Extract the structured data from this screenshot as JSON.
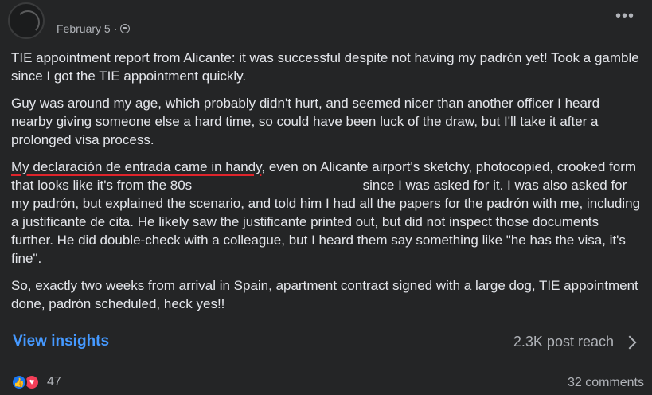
{
  "post": {
    "date": "February 5",
    "dot": "·",
    "privacy_icon": "globe-icon",
    "more_icon": "more-icon"
  },
  "body": {
    "p1": "TIE appointment report from Alicante: it was successful despite not having my padrón yet! Took a gamble since I got the TIE appointment quickly.",
    "p2": "Guy was around my age, which probably didn't hurt, and seemed nicer than another officer I heard nearby giving someone else a hard time, so could have been luck of the draw, but I'll take it after a prolonged visa process.",
    "p3_underlined": "My declaración de entrada came in handy",
    "p3_a": ", even on Alicante airport's sketchy, photocopied, crooked form that looks like it's from the 80s",
    "p3_b": "since I was asked for it. I was also asked for my padrón, but explained the scenario, and told him I had all the papers for the padrón with me, including a justificante de cita. He likely saw the justificante printed out, but did not inspect those documents further. He did double-check with a colleague, but I heard them say something like \"he has the visa, it's fine\".",
    "p4": "So, exactly two weeks from arrival in Spain, apartment contract signed with a large dog, TIE appointment done, padrón scheduled, heck yes!!"
  },
  "footer": {
    "insights_label": "View insights",
    "reach_label": "2.3K post reach",
    "reaction_count": "47",
    "comments_label": "32 comments"
  },
  "colors": {
    "background": "#242526",
    "link": "#4599ff",
    "underline": "#e0242b",
    "like": "#1877f2",
    "love": "#f33e58"
  }
}
